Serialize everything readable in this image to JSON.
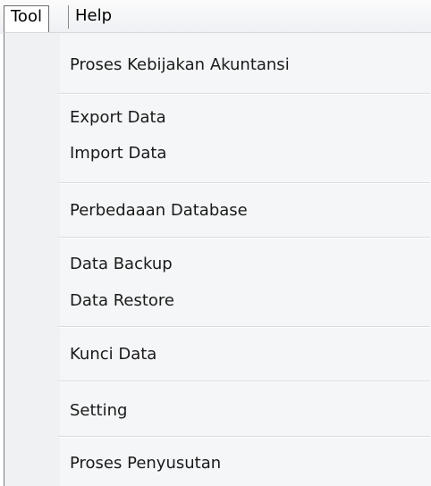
{
  "menubar": {
    "items": [
      {
        "label": "Tool"
      },
      {
        "label": "Help"
      }
    ]
  },
  "dropdown": {
    "items": [
      {
        "label": "Proses Kebijakan Akuntansi"
      },
      {
        "label": "Export Data"
      },
      {
        "label": "Import Data"
      },
      {
        "label": "Perbedaaan Database"
      },
      {
        "label": "Data Backup"
      },
      {
        "label": "Data Restore"
      },
      {
        "label": "Kunci Data"
      },
      {
        "label": "Setting"
      },
      {
        "label": "Proses Penyusutan"
      }
    ]
  }
}
